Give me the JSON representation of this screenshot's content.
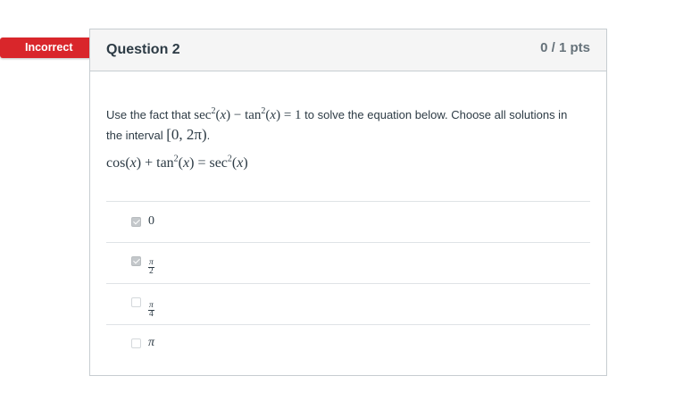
{
  "badge": {
    "label": "Incorrect",
    "color": "#d9262b"
  },
  "question": {
    "title": "Question 2",
    "points": "0 / 1 pts",
    "prompt_before": "Use the fact that ",
    "identity": {
      "sec": "sec",
      "tan": "tan",
      "exp": "2",
      "var": "x",
      "minus": "−",
      "equals": "=",
      "one": "1"
    },
    "prompt_middle": " to solve the equation below. Choose all solutions in the interval ",
    "interval": "[0, 2π)",
    "prompt_after": ".",
    "equation": {
      "cos": "cos",
      "tan": "tan",
      "sec": "sec",
      "exp": "2",
      "var": "x",
      "plus": "+",
      "equals": "="
    }
  },
  "answers": [
    {
      "label": "0",
      "checked": true
    },
    {
      "num": "π",
      "den": "2",
      "checked": true
    },
    {
      "num": "π",
      "den": "4",
      "checked": false
    },
    {
      "label": "π",
      "checked": false
    }
  ]
}
